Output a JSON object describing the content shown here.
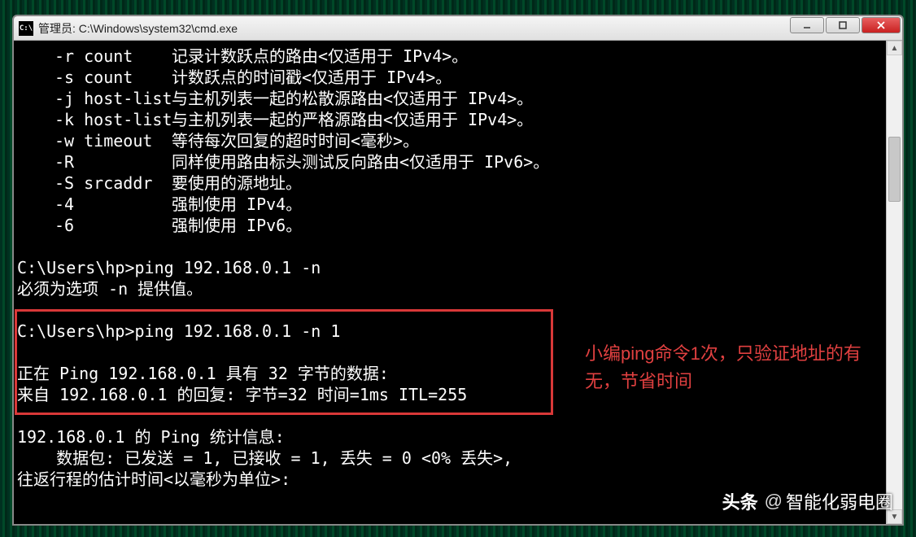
{
  "titlebar": {
    "icon_label": "C:\\",
    "text": "管理员: C:\\Windows\\system32\\cmd.exe"
  },
  "options": [
    {
      "flag": "-r count",
      "desc": "记录计数跃点的路由<仅适用于 IPv4>。"
    },
    {
      "flag": "-s count",
      "desc": "计数跃点的时间戳<仅适用于 IPv4>。"
    },
    {
      "flag": "-j host-list",
      "desc": "与主机列表一起的松散源路由<仅适用于 IPv4>。"
    },
    {
      "flag": "-k host-list",
      "desc": "与主机列表一起的严格源路由<仅适用于 IPv4>。"
    },
    {
      "flag": "-w timeout",
      "desc": "等待每次回复的超时时间<毫秒>。"
    },
    {
      "flag": "-R",
      "desc": "同样使用路由标头测试反向路由<仅适用于 IPv6>。"
    },
    {
      "flag": "-S srcaddr",
      "desc": "要使用的源地址。"
    },
    {
      "flag": "-4",
      "desc": "强制使用 IPv4。"
    },
    {
      "flag": "-6",
      "desc": "强制使用 IPv6。"
    }
  ],
  "block1": {
    "cmd": "C:\\Users\\hp>ping 192.168.0.1 -n",
    "err": "必须为选项 -n 提供值。"
  },
  "block2": {
    "cmd": "C:\\Users\\hp>ping 192.168.0.1 -n 1",
    "l1": "正在 Ping 192.168.0.1 具有 32 字节的数据:",
    "l2": "来自 192.168.0.1 的回复: 字节=32 时间=1ms ITL=255"
  },
  "stats": {
    "header": "192.168.0.1 的 Ping 统计信息:",
    "pkts": "    数据包: 已发送 = 1, 已接收 = 1, 丢失 = 0 <0% 丢失>,",
    "rtt": "往返行程的估计时间<以毫秒为单位>:"
  },
  "annotation": "小编ping命令1次，只验证地址的有无，节省时间",
  "watermark": {
    "brand": "头条",
    "at": "@",
    "name": "智能化弱电圈"
  }
}
